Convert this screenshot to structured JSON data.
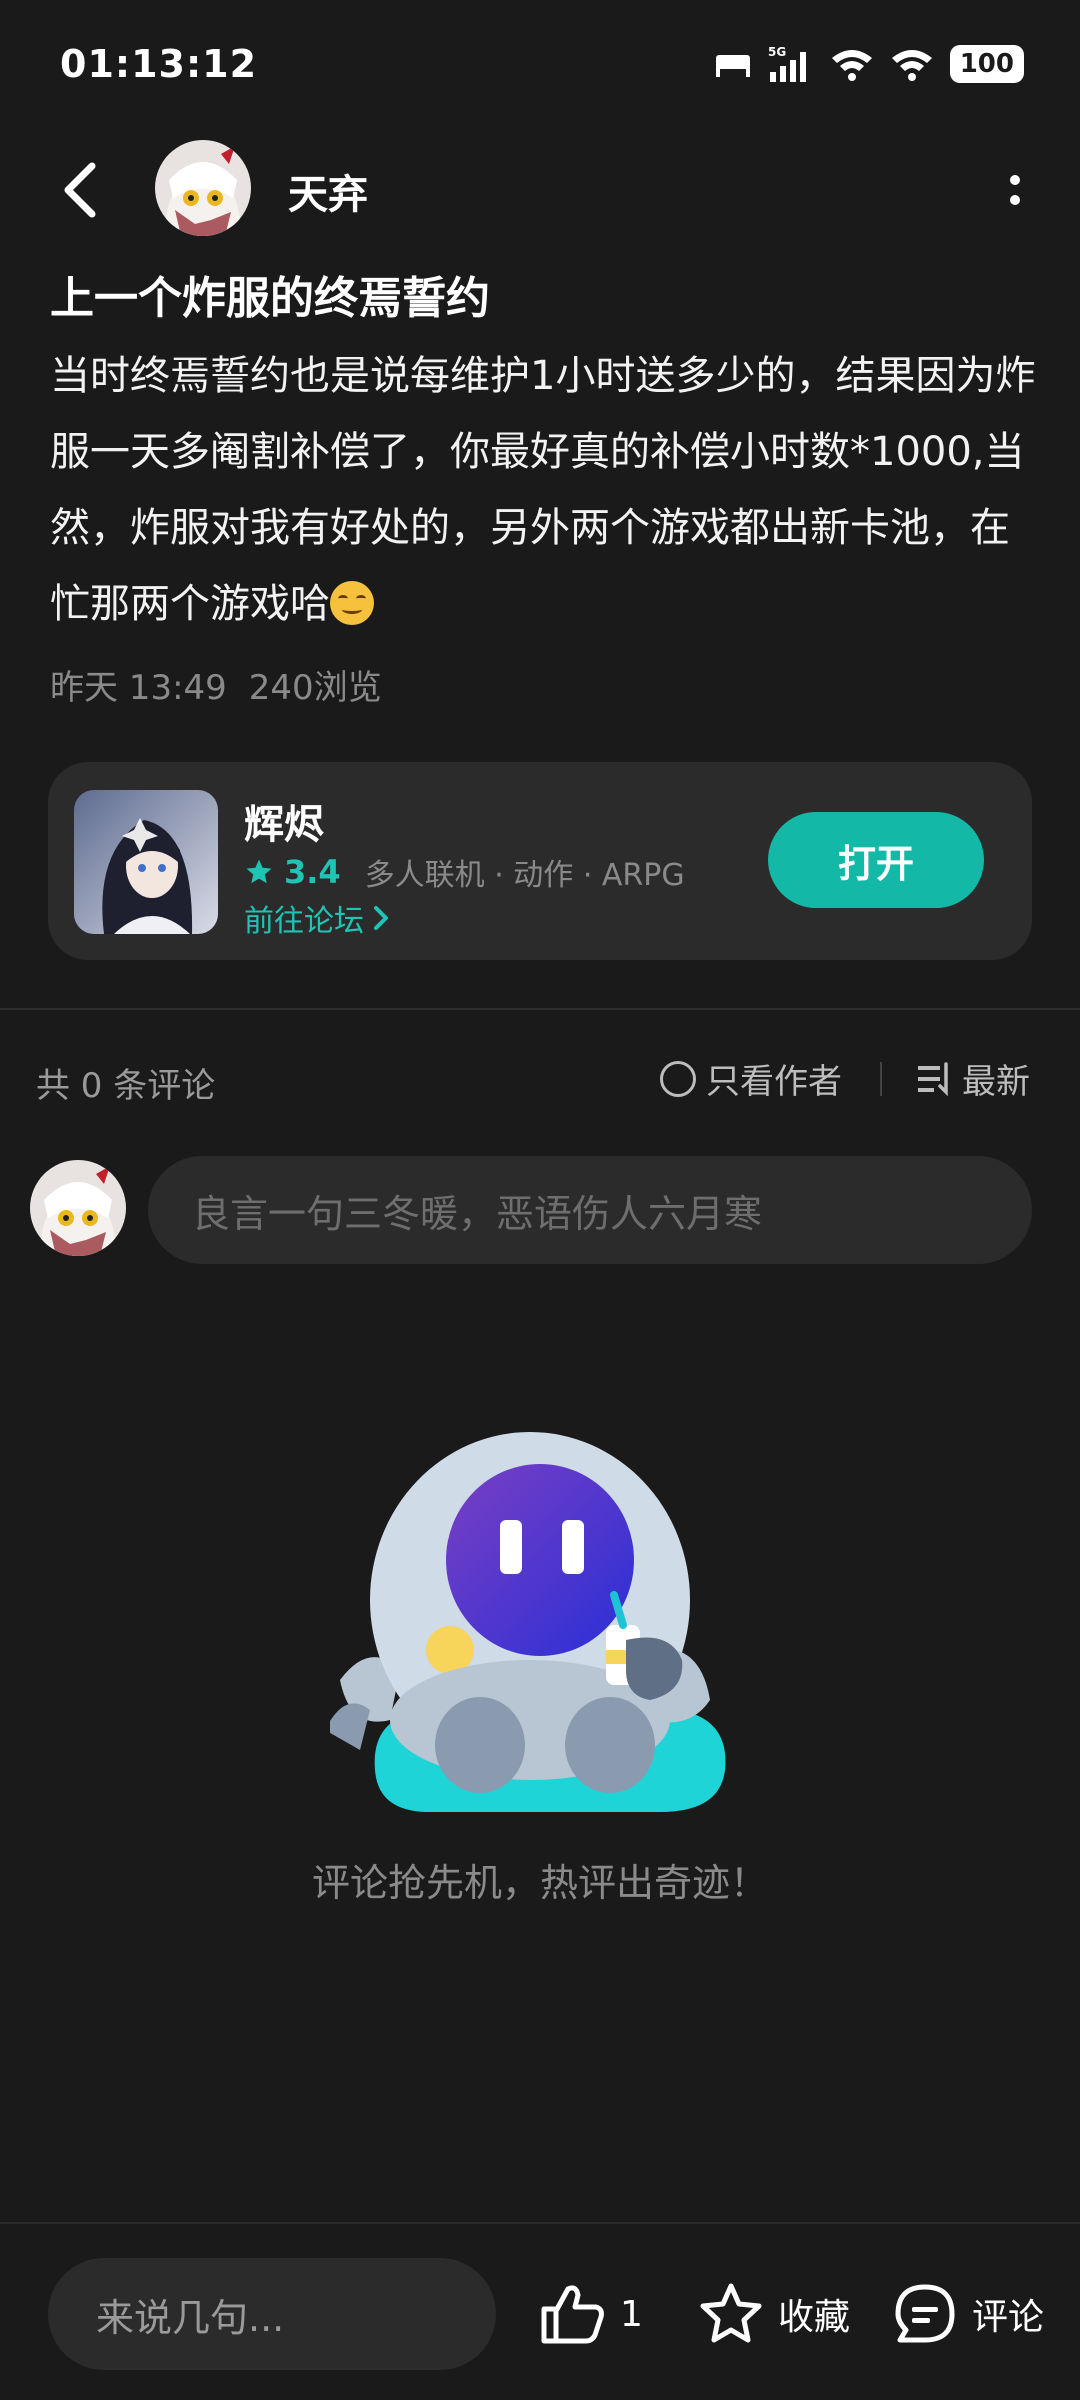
{
  "status_bar": {
    "time": "01:13:12",
    "network": "5G",
    "battery": "100"
  },
  "header": {
    "author_name": "天弃",
    "icons": [
      "back-icon",
      "more-icon"
    ]
  },
  "post": {
    "title": "上一个炸服的终焉誓约",
    "body": "当时终焉誓约也是说每维护1小时送多少的，结果因为炸服一天多阉割补偿了，你最好真的补偿小时数*1000,当然，炸服对我有好处的，另外两个游戏都出新卡池，在忙那两个游戏哈",
    "emoji": "smiling-face",
    "date": "昨天 13:49",
    "views": "240浏览"
  },
  "game_card": {
    "name": "辉烬",
    "rating": "3.4",
    "tags": "多人联机 · 动作 · ARPG",
    "forum_link": "前往论坛",
    "open_button": "打开",
    "accent": "#14b8a6"
  },
  "comments": {
    "count_label": "共 0 条评论",
    "filter_author": "只看作者",
    "sort_label": "最新",
    "input_placeholder": "良言一句三冬暖，恶语伤人六月寒",
    "empty_text": "评论抢先机，热评出奇迹！"
  },
  "bottom_bar": {
    "input_placeholder": "来说几句...",
    "like_count": "1",
    "favorite_label": "收藏",
    "comment_label": "评论"
  }
}
